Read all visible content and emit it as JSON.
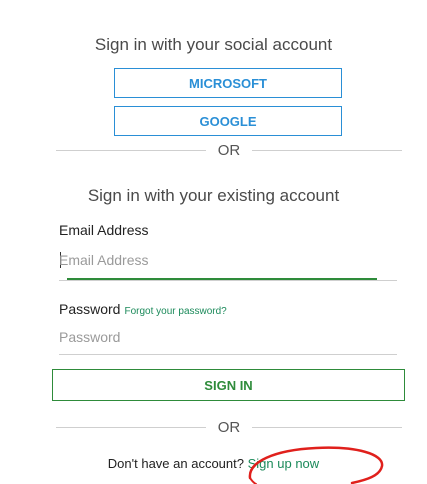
{
  "social": {
    "heading": "Sign in with your social account",
    "microsoft_label": "MICROSOFT",
    "google_label": "GOOGLE"
  },
  "divider_1": {
    "text": "OR"
  },
  "local": {
    "heading": "Sign in with your existing account",
    "email_label": "Email Address",
    "email_placeholder": "Email Address",
    "password_label": "Password",
    "forgot_label": "Forgot your password?",
    "password_placeholder": "Password",
    "signin_label": "SIGN IN"
  },
  "divider_2": {
    "text": "OR"
  },
  "signup": {
    "prompt": "Don't have an account?",
    "link_label": "Sign up now"
  },
  "colors": {
    "social_accent": "#2a8fd6",
    "primary_accent": "#2e8b3a",
    "annotation": "#e0201c"
  }
}
